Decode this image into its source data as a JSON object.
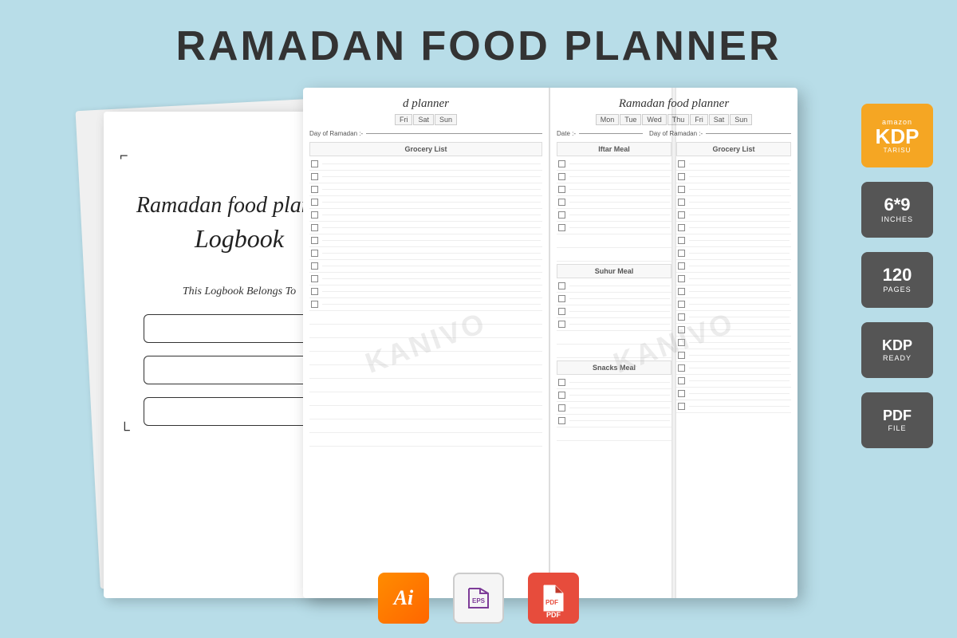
{
  "page": {
    "title": "RAMADAN FOOD PLANNER",
    "background_color": "#b8dde8"
  },
  "cover": {
    "title_line1": "Ramadan food planner",
    "title_line2": "Logbook",
    "belongs_to": "This Logbook Belongs To"
  },
  "left_page": {
    "script_title": "d planner",
    "days": [
      "Fri",
      "Sat",
      "Sun"
    ],
    "day_of_ramadan_label": "Day of Ramadan :-",
    "section": {
      "name": "Grocery List",
      "rows": 12
    }
  },
  "right_page": {
    "script_title": "Ramadan food planner",
    "days": [
      "Mon",
      "Tue",
      "Wed",
      "Thu",
      "Fri",
      "Sat",
      "Sun"
    ],
    "date_label": "Date :-",
    "day_of_ramadan_label": "Day of Ramadan :-",
    "sections": [
      {
        "name": "Iftar Meal",
        "rows": 8
      },
      {
        "name": "Suhur Meal",
        "rows": 6
      },
      {
        "name": "Snacks Meal",
        "rows": 5
      },
      {
        "name": "Grocery List",
        "rows": 10
      }
    ]
  },
  "badges": [
    {
      "id": "amazon-kdp",
      "top": "amazon",
      "main": "KDP",
      "sub": "TARISU"
    },
    {
      "id": "size",
      "num": "6*9",
      "label": "INCHES"
    },
    {
      "id": "pages",
      "num": "120",
      "label": "PAGES"
    },
    {
      "id": "kdp-ready",
      "num": "KDP",
      "label": "READY"
    },
    {
      "id": "pdf-file",
      "num": "PDF",
      "label": "FILE"
    }
  ],
  "file_formats": [
    {
      "id": "ai",
      "label": "Ai",
      "type": "ai"
    },
    {
      "id": "eps",
      "label": "EPS",
      "type": "eps"
    },
    {
      "id": "pdf",
      "label": "PDF",
      "type": "pdf"
    }
  ],
  "watermark": "KANIVO"
}
